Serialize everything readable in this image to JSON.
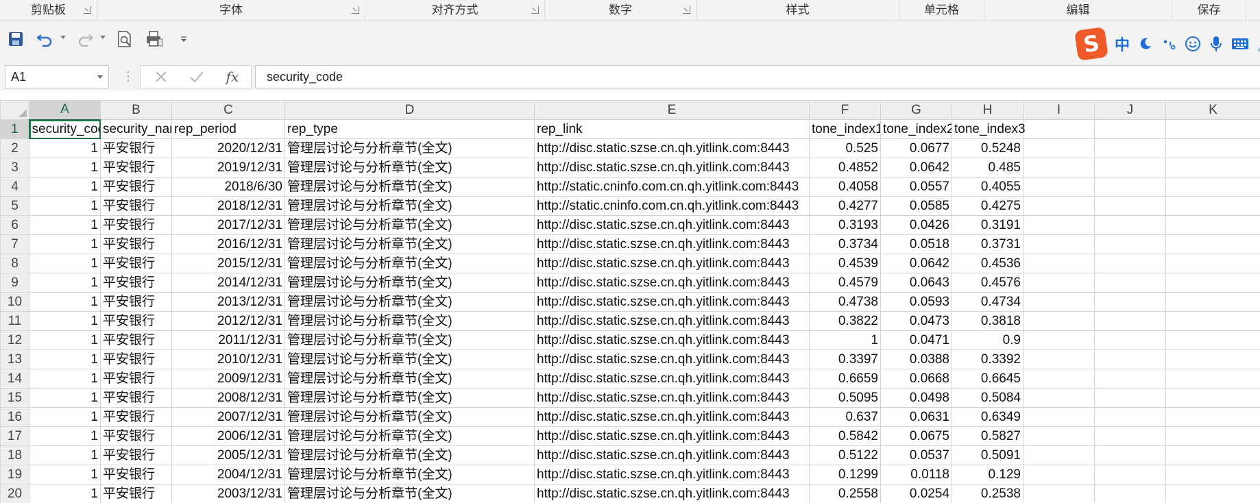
{
  "ribbon": {
    "groups": [
      {
        "label": "剪贴板",
        "launcher": true
      },
      {
        "label": "字体",
        "launcher": true
      },
      {
        "label": "对齐方式",
        "launcher": true
      },
      {
        "label": "数字",
        "launcher": true
      },
      {
        "label": "样式",
        "launcher": false
      },
      {
        "label": "单元格",
        "launcher": false
      },
      {
        "label": "编辑",
        "launcher": false
      },
      {
        "label": "保存",
        "launcher": false
      }
    ]
  },
  "quick_access": {
    "icons": [
      "save-icon",
      "undo-icon",
      "redo-icon",
      "print-preview-icon",
      "print-icon",
      "customize-toolbar-icon"
    ]
  },
  "ime": {
    "logo": "S",
    "mode": "中",
    "icons": [
      "moon-icon",
      "punctuation-icon",
      "emoji-icon",
      "microphone-icon",
      "keyboard-icon",
      "user-icon"
    ]
  },
  "formula_bar": {
    "name_box": "A1",
    "fx": "fx",
    "content": "security_code"
  },
  "sheet": {
    "columns": [
      "A",
      "B",
      "C",
      "D",
      "E",
      "F",
      "G",
      "H",
      "I",
      "J",
      "K"
    ],
    "selected_column": "A",
    "selected_row": "1",
    "header_row": [
      "security_code",
      "security_name",
      "rep_period",
      "rep_type",
      "rep_link",
      "tone_index1",
      "tone_index2",
      "tone_index3",
      "",
      "",
      ""
    ],
    "rows": [
      {
        "n": "2",
        "cells": [
          "1",
          "平安银行",
          "2020/12/31",
          "管理层讨论与分析章节(全文)",
          "http://disc.static.szse.cn.qh.yitlink.com:8443",
          "0.525",
          "0.0677",
          "0.5248"
        ]
      },
      {
        "n": "3",
        "cells": [
          "1",
          "平安银行",
          "2019/12/31",
          "管理层讨论与分析章节(全文)",
          "http://disc.static.szse.cn.qh.yitlink.com:8443",
          "0.4852",
          "0.0642",
          "0.485"
        ]
      },
      {
        "n": "4",
        "cells": [
          "1",
          "平安银行",
          "2018/6/30",
          "管理层讨论与分析章节(全文)",
          "http://static.cninfo.com.cn.qh.yitlink.com:8443",
          "0.4058",
          "0.0557",
          "0.4055"
        ]
      },
      {
        "n": "5",
        "cells": [
          "1",
          "平安银行",
          "2018/12/31",
          "管理层讨论与分析章节(全文)",
          "http://static.cninfo.com.cn.qh.yitlink.com:8443",
          "0.4277",
          "0.0585",
          "0.4275"
        ]
      },
      {
        "n": "6",
        "cells": [
          "1",
          "平安银行",
          "2017/12/31",
          "管理层讨论与分析章节(全文)",
          "http://disc.static.szse.cn.qh.yitlink.com:8443",
          "0.3193",
          "0.0426",
          "0.3191"
        ]
      },
      {
        "n": "7",
        "cells": [
          "1",
          "平安银行",
          "2016/12/31",
          "管理层讨论与分析章节(全文)",
          "http://disc.static.szse.cn.qh.yitlink.com:8443",
          "0.3734",
          "0.0518",
          "0.3731"
        ]
      },
      {
        "n": "8",
        "cells": [
          "1",
          "平安银行",
          "2015/12/31",
          "管理层讨论与分析章节(全文)",
          "http://disc.static.szse.cn.qh.yitlink.com:8443",
          "0.4539",
          "0.0642",
          "0.4536"
        ]
      },
      {
        "n": "9",
        "cells": [
          "1",
          "平安银行",
          "2014/12/31",
          "管理层讨论与分析章节(全文)",
          "http://disc.static.szse.cn.qh.yitlink.com:8443",
          "0.4579",
          "0.0643",
          "0.4576"
        ]
      },
      {
        "n": "10",
        "cells": [
          "1",
          "平安银行",
          "2013/12/31",
          "管理层讨论与分析章节(全文)",
          "http://disc.static.szse.cn.qh.yitlink.com:8443",
          "0.4738",
          "0.0593",
          "0.4734"
        ]
      },
      {
        "n": "11",
        "cells": [
          "1",
          "平安银行",
          "2012/12/31",
          "管理层讨论与分析章节(全文)",
          "http://disc.static.szse.cn.qh.yitlink.com:8443",
          "0.3822",
          "0.0473",
          "0.3818"
        ]
      },
      {
        "n": "12",
        "cells": [
          "1",
          "平安银行",
          "2011/12/31",
          "管理层讨论与分析章节(全文)",
          "http://disc.static.szse.cn.qh.yitlink.com:8443",
          "1",
          "0.0471",
          "0.9"
        ]
      },
      {
        "n": "13",
        "cells": [
          "1",
          "平安银行",
          "2010/12/31",
          "管理层讨论与分析章节(全文)",
          "http://disc.static.szse.cn.qh.yitlink.com:8443",
          "0.3397",
          "0.0388",
          "0.3392"
        ]
      },
      {
        "n": "14",
        "cells": [
          "1",
          "平安银行",
          "2009/12/31",
          "管理层讨论与分析章节(全文)",
          "http://disc.static.szse.cn.qh.yitlink.com:8443",
          "0.6659",
          "0.0668",
          "0.6645"
        ]
      },
      {
        "n": "15",
        "cells": [
          "1",
          "平安银行",
          "2008/12/31",
          "管理层讨论与分析章节(全文)",
          "http://disc.static.szse.cn.qh.yitlink.com:8443",
          "0.5095",
          "0.0498",
          "0.5084"
        ]
      },
      {
        "n": "16",
        "cells": [
          "1",
          "平安银行",
          "2007/12/31",
          "管理层讨论与分析章节(全文)",
          "http://disc.static.szse.cn.qh.yitlink.com:8443",
          "0.637",
          "0.0631",
          "0.6349"
        ]
      },
      {
        "n": "17",
        "cells": [
          "1",
          "平安银行",
          "2006/12/31",
          "管理层讨论与分析章节(全文)",
          "http://disc.static.szse.cn.qh.yitlink.com:8443",
          "0.5842",
          "0.0675",
          "0.5827"
        ]
      },
      {
        "n": "18",
        "cells": [
          "1",
          "平安银行",
          "2005/12/31",
          "管理层讨论与分析章节(全文)",
          "http://disc.static.szse.cn.qh.yitlink.com:8443",
          "0.5122",
          "0.0537",
          "0.5091"
        ]
      },
      {
        "n": "19",
        "cells": [
          "1",
          "平安银行",
          "2004/12/31",
          "管理层讨论与分析章节(全文)",
          "http://disc.static.szse.cn.qh.yitlink.com:8443",
          "0.1299",
          "0.0118",
          "0.129"
        ]
      },
      {
        "n": "20",
        "cells": [
          "1",
          "平安银行",
          "2003/12/31",
          "管理层讨论与分析章节(全文)",
          "http://disc.static.szse.cn.qh.yitlink.com:8443",
          "0.2558",
          "0.0254",
          "0.2538"
        ]
      }
    ]
  },
  "colors": {
    "accent": "#217346",
    "ime_logo": "#f05a28",
    "ime_blue": "#1a6fd8",
    "save_icon": "#2d5b9a",
    "undo_icon": "#2d6fc4"
  }
}
